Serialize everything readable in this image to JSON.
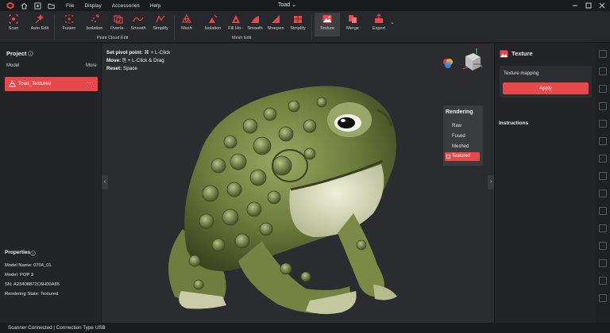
{
  "app": {
    "window_title": "Toad",
    "menu": [
      "File",
      "Display",
      "Accessories",
      "Help"
    ]
  },
  "toolbar": {
    "scan": "Scan",
    "auto_edit": "Auto Edit",
    "fusion": "Fusion",
    "isolation_pc": "Isolation",
    "overlap": "Overla··",
    "smooth_pc": "Smooth",
    "simplify_pc": "Simplify",
    "point_cloud_group": "Point Cloud Edit",
    "mesh": "Mesh",
    "isolation_mesh": "Isolation",
    "fill_holes": "Fill Ho··",
    "smooth_mesh": "Smooth",
    "sharpen": "Sharpen",
    "simplify_mesh": "Simplify",
    "mesh_group": "Mesh Edit",
    "texture": "Texture",
    "merge": "Merge",
    "export": "Export"
  },
  "left_panel": {
    "title": "Project",
    "col_model": "Model",
    "col_more": "More",
    "model_item": "Toad_Textured",
    "properties_title": "Properties",
    "props": {
      "model_name": "Model Name:  0704_01",
      "model": "Model:  POP 3",
      "sn": "SN:  A23408872C6H00A85",
      "rendering_state": "Rendering State:  Textured"
    }
  },
  "viewport": {
    "hint_pivot_label": "Set pivot point:",
    "hint_pivot_value": " ⌘ + L-Click",
    "hint_move_label": "Move:",
    "hint_move_value": " ⎘ + L-Click & Drag",
    "hint_reset_label": "Reset:",
    "hint_reset_value": " Space",
    "rendering": {
      "title": "Rendering",
      "options": [
        "Raw",
        "Fused",
        "Meshed"
      ],
      "selected": "Textured"
    },
    "cube_label": "FRONT"
  },
  "right_panel": {
    "title": "Texture",
    "texture_mapping": "Texture mapping",
    "apply": "Apply",
    "instructions": "Instructions"
  },
  "status": {
    "text": "Scanner Connected | Connection Type USB"
  },
  "colors": {
    "accent": "#e8484a",
    "panel": "#232427",
    "viewport": "#2b2c2f"
  },
  "icons": [
    "app-logo-icon",
    "home-icon",
    "add-icon",
    "folder-icon",
    "minimize-icon",
    "maximize-icon",
    "close-icon",
    "axis-cube-icon",
    "color-wheel-icon",
    "info-icon",
    "more-dots-icon"
  ]
}
